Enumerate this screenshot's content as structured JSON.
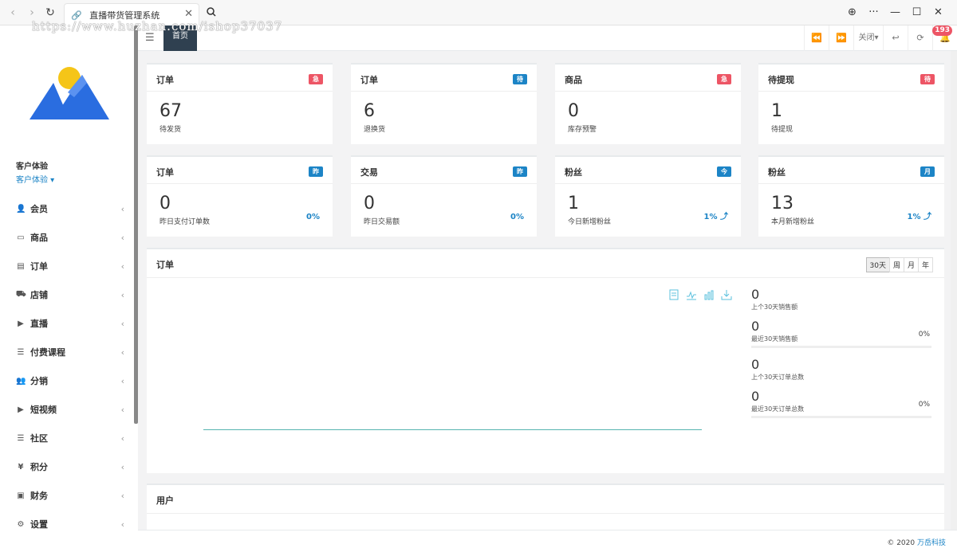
{
  "browser": {
    "tab_title": "直播带货管理系统",
    "watermark": "https://www.huzhan.com/ishop37037"
  },
  "sidebar": {
    "profile_name": "客户体验",
    "profile_role": "客户体验",
    "items": [
      {
        "label": "会员",
        "icon": "user-icon"
      },
      {
        "label": "商品",
        "icon": "laptop-icon"
      },
      {
        "label": "订单",
        "icon": "file-icon"
      },
      {
        "label": "店铺",
        "icon": "cart-icon"
      },
      {
        "label": "直播",
        "icon": "video-icon"
      },
      {
        "label": "付费课程",
        "icon": "list-icon"
      },
      {
        "label": "分销",
        "icon": "users-icon"
      },
      {
        "label": "短视频",
        "icon": "video-icon"
      },
      {
        "label": "社区",
        "icon": "list-icon"
      },
      {
        "label": "积分",
        "icon": "yen-icon"
      },
      {
        "label": "财务",
        "icon": "money-icon"
      },
      {
        "label": "设置",
        "icon": "gear-icon"
      }
    ]
  },
  "topbar": {
    "home_tab": "首页",
    "close_label": "关闭",
    "notification_count": "193"
  },
  "cards_row1": [
    {
      "title": "订单",
      "badge": "急",
      "badge_color": "red",
      "value": "67",
      "label": "待发货"
    },
    {
      "title": "订单",
      "badge": "待",
      "badge_color": "blue",
      "value": "6",
      "label": "退换货"
    },
    {
      "title": "商品",
      "badge": "急",
      "badge_color": "red",
      "value": "0",
      "label": "库存预警"
    },
    {
      "title": "待提现",
      "badge": "待",
      "badge_color": "red",
      "value": "1",
      "label": "待提现"
    }
  ],
  "cards_row2": [
    {
      "title": "订单",
      "badge": "昨",
      "badge_color": "blue",
      "value": "0",
      "label": "昨日支付订单数",
      "pct": "0%"
    },
    {
      "title": "交易",
      "badge": "昨",
      "badge_color": "blue",
      "value": "0",
      "label": "昨日交易额",
      "pct": "0%"
    },
    {
      "title": "粉丝",
      "badge": "今",
      "badge_color": "blue",
      "value": "1",
      "label": "今日新增粉丝",
      "pct": "1% ⤴"
    },
    {
      "title": "粉丝",
      "badge": "月",
      "badge_color": "blue",
      "value": "13",
      "label": "本月新增粉丝",
      "pct": "1% ⤴"
    }
  ],
  "order_panel": {
    "title": "订单",
    "periods": [
      "30天",
      "周",
      "月",
      "年"
    ],
    "active_period": "30天",
    "stats": [
      {
        "value": "0",
        "label": "上个30天销售额",
        "pct": ""
      },
      {
        "value": "0",
        "label": "最近30天销售额",
        "pct": "0%"
      },
      {
        "value": "0",
        "label": "上个30天订单总数",
        "pct": ""
      },
      {
        "value": "0",
        "label": "最近30天订单总数",
        "pct": "0%"
      }
    ]
  },
  "user_panel": {
    "title": "用户"
  },
  "footer": {
    "copyright": "© 2020 ",
    "company": "万岳科技"
  }
}
